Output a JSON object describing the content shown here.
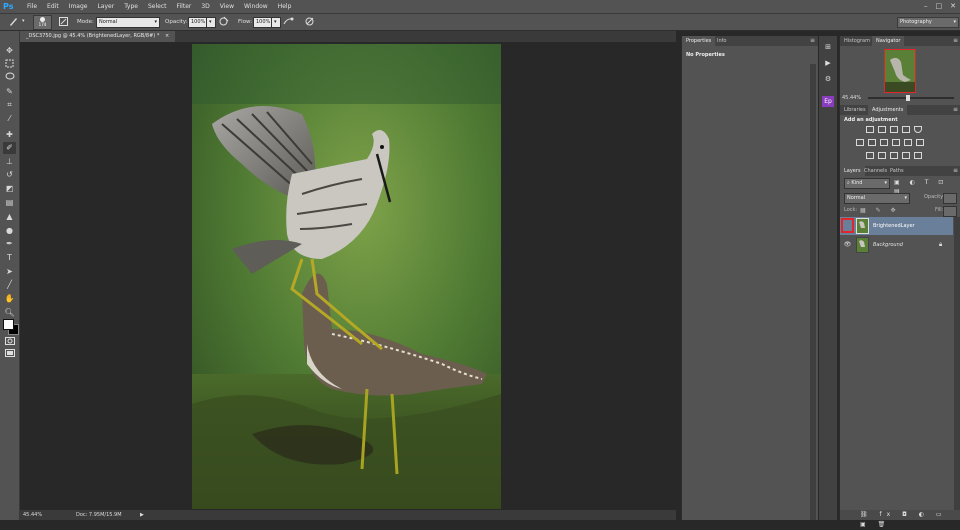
{
  "app": {
    "logo": "Ps"
  },
  "menu": [
    "File",
    "Edit",
    "Image",
    "Layer",
    "Type",
    "Select",
    "Filter",
    "3D",
    "View",
    "Window",
    "Help"
  ],
  "window_controls": [
    "–",
    "□",
    "✕"
  ],
  "options_bar": {
    "brush_size": "174",
    "mode_label": "Mode:",
    "mode_value": "Normal",
    "opacity_label": "Opacity:",
    "opacity_value": "100%",
    "flow_label": "Flow:",
    "flow_value": "100%",
    "workspace": "Photography"
  },
  "document": {
    "tab_title": "_DSC3750.jpg @ 45.4% (BrightenedLayer, RGB/8#) *",
    "tab_close": "×",
    "zoom": "45.44%",
    "doc_size": "Doc: 7.95M/15.9M"
  },
  "properties_panel": {
    "tabs": [
      "Properties",
      "Info"
    ],
    "message": "No Properties"
  },
  "navigator_panel": {
    "tabs": [
      "Histogram",
      "Navigator"
    ],
    "zoom": "45.44%"
  },
  "adjustments_panel": {
    "tabs": [
      "Libraries",
      "Adjustments"
    ],
    "heading": "Add an adjustment"
  },
  "layers_panel": {
    "tabs": [
      "Layers",
      "Channels",
      "Paths"
    ],
    "filter_kind": "Kind",
    "blend_mode": "Normal",
    "opacity_label": "Opacity:",
    "lock_label": "Lock:",
    "fill_label": "Fill:",
    "layers": [
      {
        "name": "BrightenedLayer",
        "selected": true,
        "visible": false
      },
      {
        "name": "Background",
        "selected": false,
        "visible": true,
        "locked": true
      }
    ]
  },
  "colors": {
    "selection": "#6a7f99",
    "highlight_box": "#e0252b",
    "panel": "#535353",
    "canvas": "#282828"
  }
}
